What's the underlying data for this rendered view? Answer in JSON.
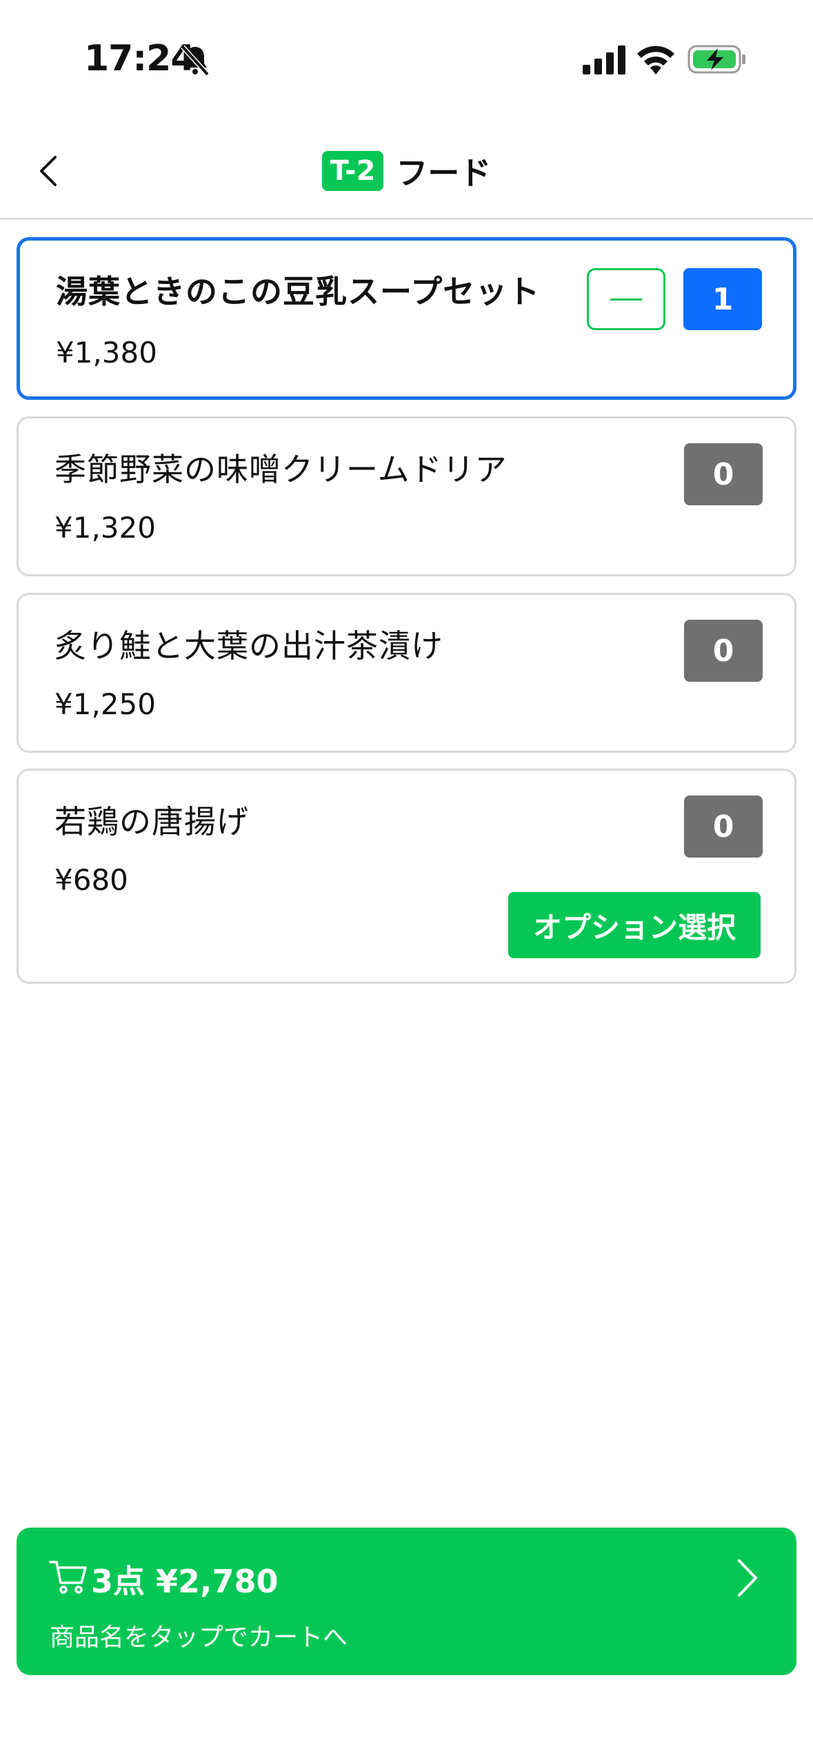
{
  "status_bar": {
    "time": "17:24"
  },
  "header": {
    "table_label": "T-2",
    "title": "フード"
  },
  "items": [
    {
      "name": "湯葉ときのこの豆乳スープセット",
      "price": "¥1,380",
      "qty": "1"
    },
    {
      "name": "季節野菜の味噌クリームドリア",
      "price": "¥1,320",
      "qty": "0"
    },
    {
      "name": "炙り鮭と大葉の出汁茶漬け",
      "price": "¥1,250",
      "qty": "0"
    },
    {
      "name": "若鶏の唐揚げ",
      "price": "¥680",
      "qty": "0",
      "option_label": "オプション選択"
    }
  ],
  "cart": {
    "summary": "3点 ¥2,780",
    "hint": "商品名をタップでカートへ"
  },
  "colors": {
    "accent_green": "#06c755",
    "selected_blue": "#1a73e8",
    "qty_blue": "#0d6efd",
    "qty_gray": "#707070"
  },
  "icons": [
    "silent-bell-icon",
    "signal-icon",
    "wifi-icon",
    "battery-charging-icon",
    "back-chevron-icon",
    "cart-icon",
    "chevron-right-icon"
  ]
}
